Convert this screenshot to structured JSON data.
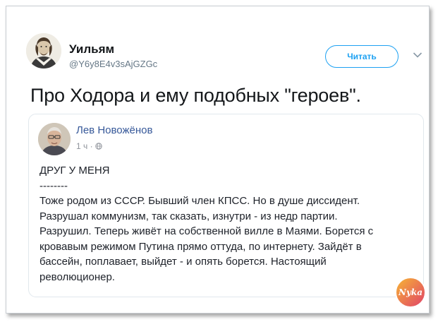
{
  "tweet": {
    "author": {
      "display_name": "Уильям",
      "handle": "@Y6y8E4v3sAjGZGc"
    },
    "follow_label": "Читать",
    "text": "Про Ходора и ему подобных \"героев\".",
    "quoted_post": {
      "author_name": "Лев Новожёнов",
      "time": "1 ч ·",
      "lines": [
        "ДРУГ У МЕНЯ",
        "--------",
        "Тоже родом из СССР. Бывший член КПСС. Но в душе диссидент.",
        "Разрушал коммунизм, так сказать, изнутри - из недр партии.",
        "Разрушил. Теперь живёт на собственной вилле в Маями. Борется с",
        "кровавым режимом Путина прямо оттуда, по интернету. Зайдёт в",
        "бассейн, поплавает, выйдет - и опять борется. Настоящий",
        "революционер."
      ]
    }
  },
  "watermark": {
    "text": "Nyka",
    "colors": [
      "#f6a623",
      "#d9346f"
    ]
  },
  "colors": {
    "accent": "#1da1f2",
    "fb_link": "#365899",
    "text": "#14171a",
    "muted": "#657786"
  },
  "icons": [
    "avatar-portrait",
    "chevron-down-icon",
    "globe-icon"
  ]
}
